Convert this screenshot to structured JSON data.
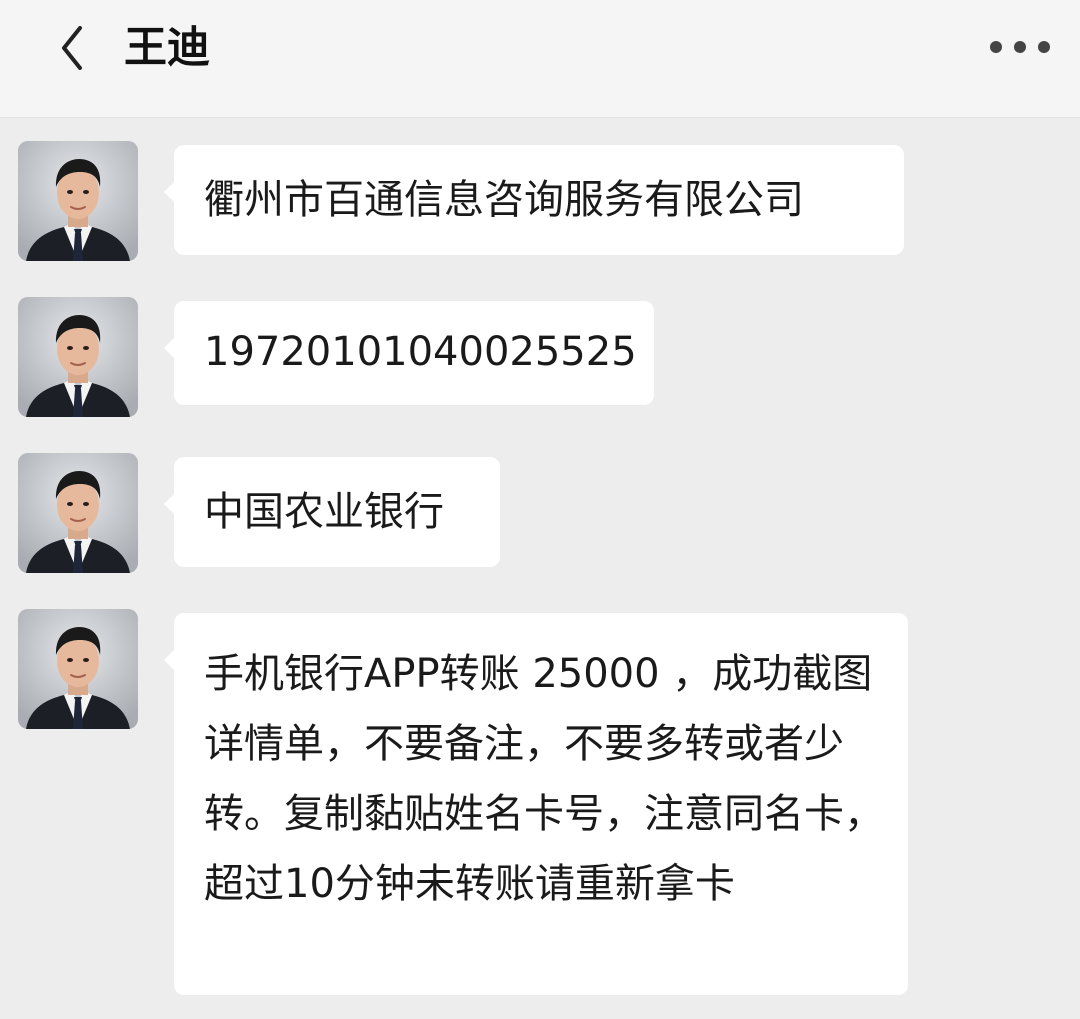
{
  "header": {
    "title": "王迪",
    "back_icon": "chevron-left-icon",
    "more_icon": "more-dots-icon"
  },
  "messages": [
    {
      "sender": "incoming",
      "text": "衢州市百通信息咨询服务有限公司"
    },
    {
      "sender": "incoming",
      "text": "19720101040025525"
    },
    {
      "sender": "incoming",
      "text": "中国农业银行"
    },
    {
      "sender": "incoming",
      "text": "手机银行APP转账   25000 ，成功截图详情单，不要备注，不要多转或者少转。复制黏贴姓名卡号，注意同名卡，超过10分钟未转账请重新拿卡"
    }
  ],
  "colors": {
    "background": "#ededed",
    "nav_background": "#f5f5f5",
    "bubble": "#ffffff",
    "text": "#1a1a1a"
  }
}
